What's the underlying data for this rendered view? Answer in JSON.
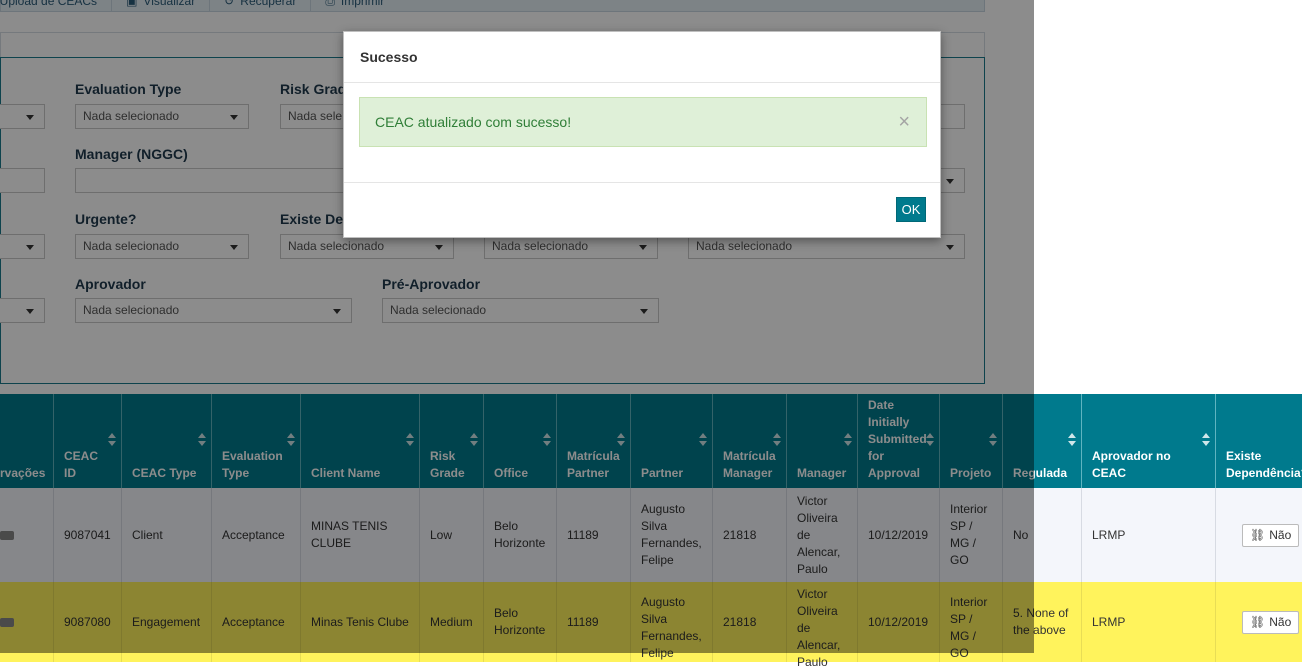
{
  "toolbar": {
    "items": [
      "cio Upload de CEACs",
      "Visualizar",
      "Recuperar",
      "Imprimir"
    ]
  },
  "filters": {
    "evaluation_type": {
      "label": "Evaluation Type",
      "value": "Nada selecionado"
    },
    "risk_grade": {
      "label": "Risk Grade",
      "value": "Nada sele"
    },
    "manager_nggc": {
      "label": "Manager (NGGC)",
      "value": ""
    },
    "urgente": {
      "label": "Urgente?",
      "value": "Nada selecionado"
    },
    "existe_dep": {
      "label": "Existe Dep",
      "value": "Nada selecionado"
    },
    "filter_c": {
      "value": "Nada selecionado"
    },
    "filter_d": {
      "value": "Nada selecionado"
    },
    "aprovador": {
      "label": "Aprovador",
      "value": "Nada selecionado"
    },
    "pre_aprovador": {
      "label": "Pré-Aprovador",
      "value": "Nada selecionado"
    }
  },
  "table": {
    "headers": [
      "rvações",
      "CEAC ID",
      "CEAC Type",
      "Evaluation Type",
      "Client Name",
      "Risk Grade",
      "Office",
      "Matrícula Partner",
      "Partner",
      "Matrícula Manager",
      "Manager",
      "Date Initially Submitted for Approval",
      "Projeto",
      "Regulada",
      "Aprovador no CEAC",
      "Existe Dependência?"
    ],
    "rows": [
      {
        "ceac_id": "9087041",
        "ceac_type": "Client",
        "eval_type": "Acceptance",
        "client": "MINAS TENIS CLUBE",
        "risk": "Low",
        "office": "Belo Horizonte",
        "mat_partner": "11189",
        "partner": "Augusto Silva Fernandes, Felipe",
        "mat_manager": "21818",
        "manager": "Victor Oliveira de Alencar, Paulo",
        "date": "10/12/2019",
        "projeto": "Interior SP / MG / GO",
        "regulada": "No",
        "aprovador": "LRMP",
        "dep": "Não"
      },
      {
        "ceac_id": "9087080",
        "ceac_type": "Engagement",
        "eval_type": "Acceptance",
        "client": "Minas Tenis Clube",
        "risk": "Medium",
        "office": "Belo Horizonte",
        "mat_partner": "11189",
        "partner": "Augusto Silva Fernandes, Felipe",
        "mat_manager": "21818",
        "manager": "Victor Oliveira de Alencar, Paulo",
        "date": "10/12/2019",
        "projeto": "Interior SP / MG / GO",
        "regulada": "5. None of the above",
        "aprovador": "LRMP",
        "dep": "Não"
      }
    ]
  },
  "modal": {
    "title": "Sucesso",
    "message": "CEAC atualizado com sucesso!",
    "close_glyph": "×",
    "ok_label": "OK"
  },
  "colors": {
    "header_teal": "#007a8d",
    "highlight_row": "#fff35c",
    "success_bg": "#dff0d8",
    "success_text": "#2f7e37"
  }
}
